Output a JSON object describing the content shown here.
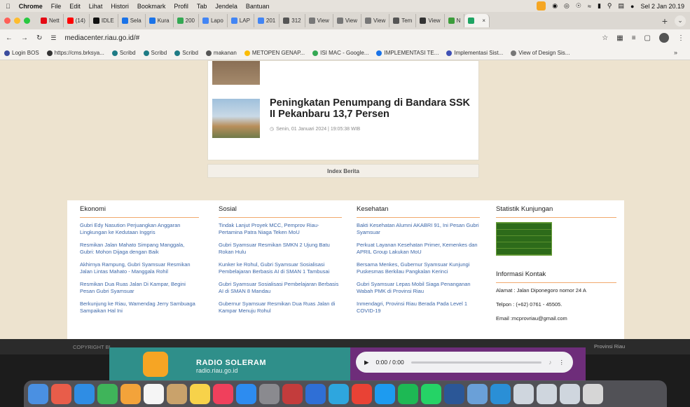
{
  "menubar": {
    "app": "Chrome",
    "items": [
      "File",
      "Edit",
      "Lihat",
      "Histori",
      "Bookmark",
      "Profil",
      "Tab",
      "Jendela",
      "Bantuan"
    ],
    "datetime": "Sel 2 Jan 20.19"
  },
  "tabs": [
    {
      "label": "Nett",
      "color": "#e50914"
    },
    {
      "label": "(14)",
      "color": "#ff0000"
    },
    {
      "label": "IDLE",
      "color": "#111111"
    },
    {
      "label": "Sela",
      "color": "#1a73e8"
    },
    {
      "label": "Kura",
      "color": "#1a73e8"
    },
    {
      "label": "200",
      "color": "#34a853"
    },
    {
      "label": "Lapo",
      "color": "#4285f4"
    },
    {
      "label": "LAP",
      "color": "#4285f4"
    },
    {
      "label": "201",
      "color": "#4285f4"
    },
    {
      "label": "312",
      "color": "#555555"
    },
    {
      "label": "View",
      "color": "#777777"
    },
    {
      "label": "View",
      "color": "#777777"
    },
    {
      "label": "View",
      "color": "#777777"
    },
    {
      "label": "Tem",
      "color": "#555555"
    },
    {
      "label": "View",
      "color": "#333333"
    },
    {
      "label": "N",
      "color": "#3c9d3c"
    },
    {
      "label": "",
      "color": "#1fa463",
      "active": true
    }
  ],
  "address": {
    "url": "mediacenter.riau.go.id/#"
  },
  "bookmarks": [
    {
      "label": "Login BOS",
      "color": "#3b4c9e"
    },
    {
      "label": "https://cms.brksya...",
      "color": "#333333"
    },
    {
      "label": "Scribd",
      "color": "#1e7b85"
    },
    {
      "label": "Scribd",
      "color": "#1e7b85"
    },
    {
      "label": "Scribd",
      "color": "#1e7b85"
    },
    {
      "label": "makanan",
      "color": "#555555"
    },
    {
      "label": "METOPEN GENAP...",
      "color": "#fbbc04"
    },
    {
      "label": "ISI MAC - Google...",
      "color": "#34a853"
    },
    {
      "label": "IMPLEMENTASI TE...",
      "color": "#1a73e8"
    },
    {
      "label": "Implementasi Sist...",
      "color": "#3f51b5"
    },
    {
      "label": "View of Design Sis...",
      "color": "#777777"
    }
  ],
  "news": {
    "title": "Peningkatan Penumpang di Bandara SSK II Pekanbaru 13,7 Persen",
    "date": "Senin, 01 Januari 2024 | 19:05:38 WIB",
    "index_label": "Index Berita"
  },
  "footer": {
    "columns": [
      {
        "heading": "Ekonomi",
        "links": [
          "Gubri Edy Nasution Perjuangkan Anggaran Lingkungan ke Kedutaan Inggris",
          "Resmikan Jalan Mahato Simpang Manggala, Gubri: Mohon Dijaga dengan Baik",
          "Akhirnya Rampung, Gubri Syamsuar Resmikan Jalan Lintas Mahato - Manggala Rohil",
          "Resmikan Dua Ruas Jalan Di Kampar, Begini Pesan Gubri Syamsuar",
          "Berkunjung ke Riau, Wamendag Jerry Sambuaga Sampaikan Hal Ini"
        ]
      },
      {
        "heading": "Sosial",
        "links": [
          "Tindak Lanjut Proyek MCC, Pemprov Riau-Pertamina Patra Niaga Teken MoU",
          "Gubri Syamsuar Resmikan SMKN 2 Ujung Batu Rokan Hulu",
          "Kunker ke Rohul, Gubri Syamsuar Sosialisasi Pembelajaran Berbasis AI di SMAN 1 Tambusai",
          "Gubri Syamsuar Sosialisasi Pembelajaran Berbasis AI di SMAN 8 Mandau",
          "Gubernur Syamsuar Resmikan Dua Ruas Jalan di Kampar Menuju Rohul"
        ]
      },
      {
        "heading": "Kesehatan",
        "links": [
          "Bakti Kesehatan Alumni AKABRI 91, Ini Pesan Gubri Syamsuar",
          "Perkuat Layanan Kesehatan Primer, Kemenkes dan APRIL Group Lakukan MoU",
          "Bersama Menkes, Gubernur Syamsuar Kunjungi Puskesmas Berkilau Pangkalan Kerinci",
          "Gubri Syamsuar Lepas Mobil Siaga Penanganan Wabah PMK di Provinsi Riau",
          "Inmendagri, Provinsi Riau Berada Pada Level 1 COVID-19"
        ]
      }
    ],
    "stats_heading": "Statistik Kunjungan",
    "contact_heading": "Informasi Kontak",
    "contact": [
      "Alamat : Jalan Diponegoro nomor 24 A",
      "Telpon : (+62) 0761 - 45505.",
      "Email :mcprovriau@gmail.com"
    ]
  },
  "bottom": {
    "copyright": "COPYRIGHT BI",
    "province": "Provinsi Riau"
  },
  "radio": {
    "name": "RADIO SOLERAM",
    "url": "radio.riau.go.id",
    "time": "0:00 / 0:00"
  },
  "dock": [
    {
      "name": "finder-icon",
      "color": "#4a90e2"
    },
    {
      "name": "launchpad-icon",
      "color": "#e85d4a"
    },
    {
      "name": "safari-icon",
      "color": "#2f8de4"
    },
    {
      "name": "app-icon",
      "color": "#3fb45a"
    },
    {
      "name": "photos-icon",
      "color": "#f3a33a"
    },
    {
      "name": "calendar-icon",
      "color": "#f5f5f5"
    },
    {
      "name": "contacts-icon",
      "color": "#c9a26b"
    },
    {
      "name": "notes-icon",
      "color": "#f7d24a"
    },
    {
      "name": "music-icon",
      "color": "#f0405c"
    },
    {
      "name": "appstore-icon",
      "color": "#2d8cf0"
    },
    {
      "name": "settings-icon",
      "color": "#8a8a8f"
    },
    {
      "name": "app-icon",
      "color": "#c33c3c"
    },
    {
      "name": "app-icon",
      "color": "#2f6fd6"
    },
    {
      "name": "telegram-icon",
      "color": "#2ea6de"
    },
    {
      "name": "chrome-icon",
      "color": "#e94235"
    },
    {
      "name": "twitter-icon",
      "color": "#1d9bf0"
    },
    {
      "name": "spotify-icon",
      "color": "#1db954"
    },
    {
      "name": "whatsapp-icon",
      "color": "#25d366"
    },
    {
      "name": "word-icon",
      "color": "#2b5797"
    },
    {
      "name": "app-icon",
      "color": "#6aa0d8"
    },
    {
      "name": "app-icon",
      "color": "#2a8fd6"
    },
    {
      "name": "window-icon",
      "color": "#cfd6de"
    },
    {
      "name": "window-icon",
      "color": "#cfd6de"
    },
    {
      "name": "window-icon",
      "color": "#cfd6de"
    },
    {
      "name": "trash-icon",
      "color": "#d6d6d6"
    }
  ]
}
